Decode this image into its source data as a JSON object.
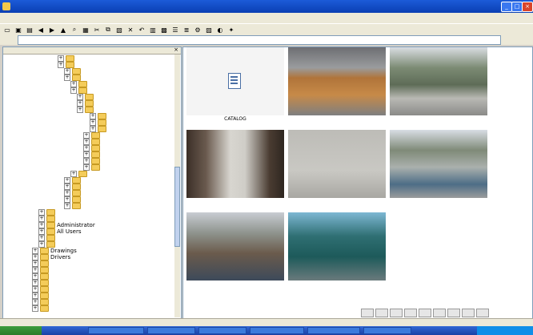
{
  "window": {
    "title": "",
    "controls": [
      "_",
      "□",
      "×"
    ]
  },
  "menu": [
    {
      "label": ""
    },
    {
      "label": ""
    },
    {
      "label": ""
    },
    {
      "label": ""
    },
    {
      "label": ""
    },
    {
      "label": ""
    },
    {
      "label": ""
    }
  ],
  "toolbar_icons": [
    "new-icon",
    "open-icon",
    "save-icon",
    "back-icon",
    "forward-icon",
    "up-icon",
    "search-icon",
    "folders-icon",
    "cut-icon",
    "copy-icon",
    "paste-icon",
    "delete-icon",
    "undo-icon",
    "views-icon",
    "thumbnail-icon",
    "list-icon",
    "details-icon",
    "tools-icon",
    "image-icon",
    "color-icon",
    "settings-icon"
  ],
  "address": {
    "label": "",
    "value": ""
  },
  "tree": {
    "items": [
      {
        "label": ""
      },
      {
        "label": ""
      },
      {
        "label": ""
      },
      {
        "label": ""
      },
      {
        "label": ""
      },
      {
        "label": ""
      },
      {
        "label": ""
      },
      {
        "label": ""
      },
      {
        "label": ""
      },
      {
        "label": ""
      },
      {
        "label": ""
      },
      {
        "label": ""
      },
      {
        "label": ""
      },
      {
        "label": ""
      },
      {
        "label": ""
      },
      {
        "label": ""
      },
      {
        "label": ""
      },
      {
        "label": ""
      },
      {
        "label": ""
      },
      {
        "label": ""
      },
      {
        "label": ""
      },
      {
        "label": ""
      },
      {
        "label": ""
      },
      {
        "label": ""
      },
      {
        "label": ""
      },
      {
        "label": ""
      },
      {
        "label": "Administrator"
      },
      {
        "label": "All Users"
      },
      {
        "label": ""
      },
      {
        "label": ""
      },
      {
        "label": "Drawings"
      },
      {
        "label": "Drivers"
      },
      {
        "label": ""
      },
      {
        "label": ""
      },
      {
        "label": ""
      },
      {
        "label": ""
      },
      {
        "label": ""
      },
      {
        "label": ""
      },
      {
        "label": ""
      },
      {
        "label": ""
      }
    ]
  },
  "thumbnails": [
    {
      "caption": "CATALOG"
    },
    {
      "caption": ""
    },
    {
      "caption": ""
    },
    {
      "caption": ""
    },
    {
      "caption": ""
    },
    {
      "caption": ""
    },
    {
      "caption": ""
    },
    {
      "caption": ""
    }
  ],
  "pager": [
    "",
    "",
    "",
    "",
    "",
    "",
    "",
    "",
    ""
  ],
  "status": {
    "left": "",
    "mid": "",
    "right": ""
  },
  "taskbar": {
    "start_label": "",
    "tasks": [
      {
        "label": ""
      },
      {
        "label": ""
      },
      {
        "label": ""
      },
      {
        "label": ""
      },
      {
        "label": ""
      },
      {
        "label": ""
      }
    ],
    "clock": ""
  }
}
